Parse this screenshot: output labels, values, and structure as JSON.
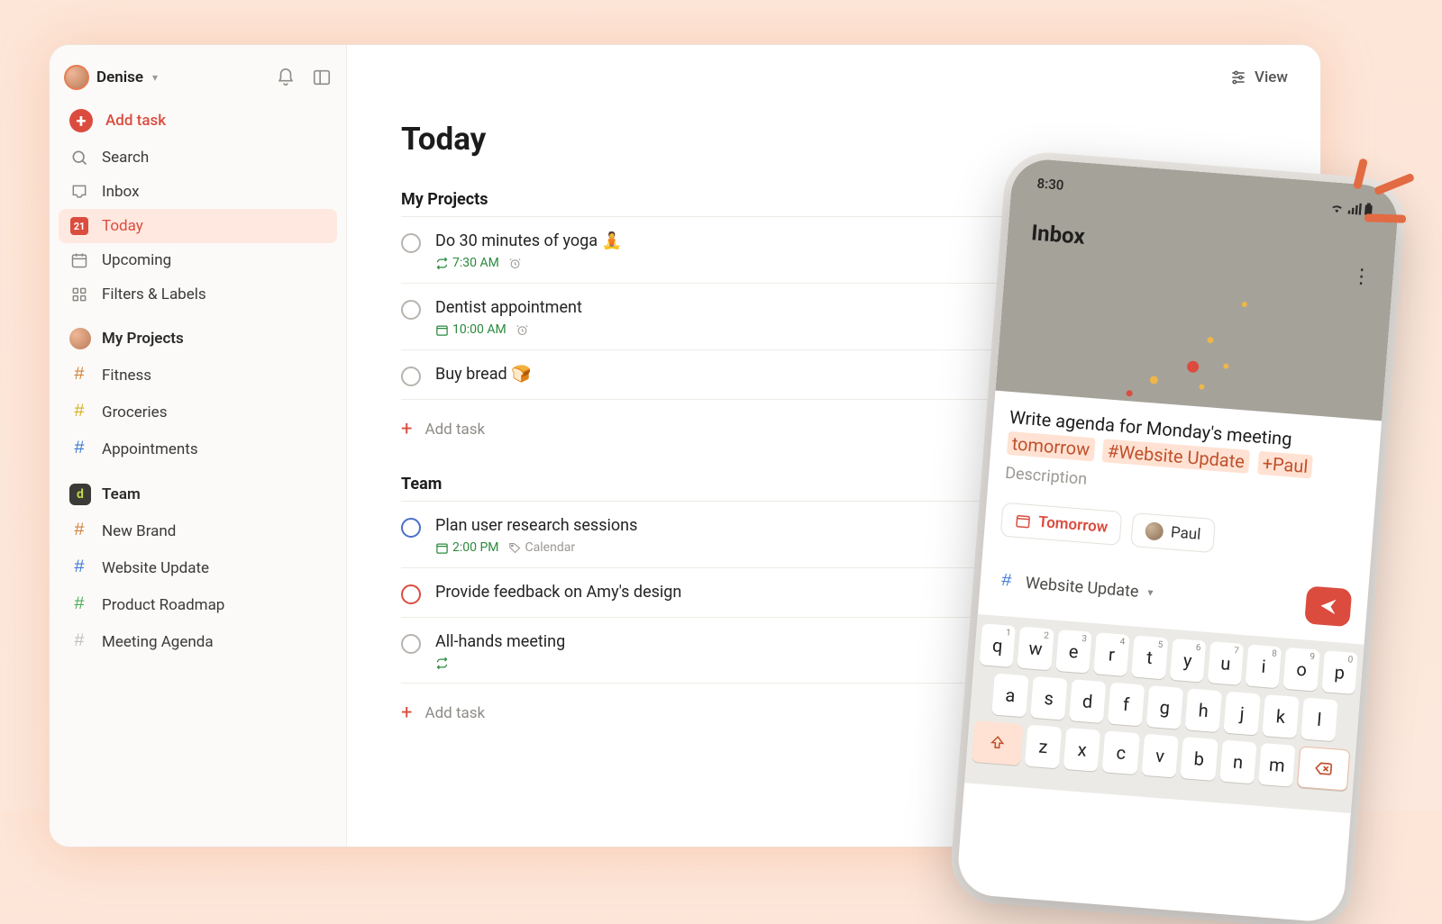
{
  "user": {
    "name": "Denise"
  },
  "sidebar": {
    "add_task": "Add task",
    "search": "Search",
    "inbox": "Inbox",
    "today": "Today",
    "today_num": "21",
    "upcoming": "Upcoming",
    "filters": "Filters & Labels",
    "my_projects": "My Projects",
    "proj": {
      "fitness": "Fitness",
      "groceries": "Groceries",
      "appointments": "Appointments"
    },
    "team": "Team",
    "team_proj": {
      "new_brand": "New Brand",
      "website": "Website Update",
      "roadmap": "Product Roadmap",
      "agenda": "Meeting Agenda"
    }
  },
  "header": {
    "view": "View"
  },
  "page": {
    "title": "Today"
  },
  "sections": {
    "my_projects": {
      "title": "My Projects",
      "t1": {
        "title": "Do 30 minutes of yoga 🧘",
        "time": "7:30 AM"
      },
      "t2": {
        "title": "Dentist appointment",
        "time": "10:00 AM"
      },
      "t3": {
        "title": "Buy bread 🍞"
      },
      "add": "Add task"
    },
    "team": {
      "title": "Team",
      "t1": {
        "title": "Plan user research sessions",
        "time": "2:00 PM",
        "loc": "Calendar"
      },
      "t2": {
        "title": "Provide feedback on Amy's design"
      },
      "t3": {
        "title": "All-hands meeting"
      },
      "add": "Add task"
    }
  },
  "phone": {
    "time": "8:30",
    "inbox": "Inbox",
    "compose_plain": "Write agenda for Monday's meeting ",
    "pill_tomorrow": "tomorrow",
    "pill_project": "#Website Update",
    "pill_assign": "+Paul",
    "description": "Description",
    "chip_tomorrow": "Tomorrow",
    "chip_paul": "Paul",
    "project": "Website Update",
    "kbd_r1": [
      "q",
      "w",
      "e",
      "r",
      "t",
      "y",
      "u",
      "i",
      "o",
      "p"
    ],
    "kbd_r1_sup": [
      "1",
      "2",
      "3",
      "4",
      "5",
      "6",
      "7",
      "8",
      "9",
      "0"
    ],
    "kbd_r2": [
      "a",
      "s",
      "d",
      "f",
      "g",
      "h",
      "j",
      "k",
      "l"
    ],
    "kbd_r3": [
      "z",
      "x",
      "c",
      "v",
      "b",
      "n",
      "m"
    ]
  }
}
